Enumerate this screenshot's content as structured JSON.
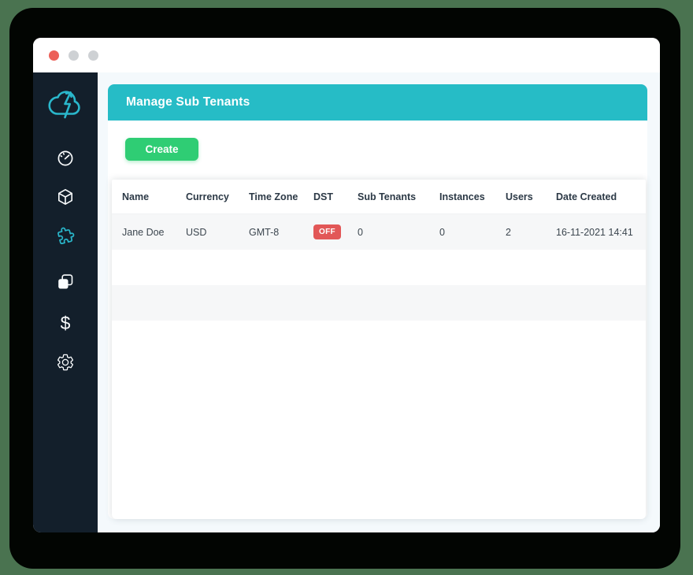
{
  "window_controls": {
    "buttons": [
      "close",
      "minimize",
      "maximize"
    ],
    "close_color": "#ec6058",
    "inactive_color": "#ced1d4"
  },
  "sidebar": {
    "logo_icon": "cloud-lightning-icon",
    "dollar_glyph": "$",
    "items": [
      {
        "icon": "speedometer-icon",
        "active": false
      },
      {
        "icon": "cube-icon",
        "active": false
      },
      {
        "icon": "puzzle-icon",
        "active": true
      },
      {
        "icon": "copy-icon",
        "active": false
      },
      {
        "icon": "dollar-icon",
        "active": false
      },
      {
        "icon": "gear-icon",
        "active": false
      }
    ]
  },
  "panel": {
    "title": "Manage Sub Tenants",
    "create_button_label": "Create"
  },
  "table": {
    "columns": [
      "Name",
      "Currency",
      "Time Zone",
      "DST",
      "Sub Tenants",
      "Instances",
      "Users",
      "Date Created"
    ],
    "row": {
      "name": "Jane Doe",
      "currency": "USD",
      "time_zone": "GMT-8",
      "dst_badge": "OFF",
      "sub_tenants": "0",
      "instances": "0",
      "users": "2",
      "date_created": "16-11-2021 14:41"
    },
    "skeleton_row_count": 3
  },
  "colors": {
    "page_background": "#4a7350",
    "backdrop": "#020502",
    "sidebar_background": "#131f2b",
    "header_teal": "#26bcc6",
    "accent_teal": "#2ab7cb",
    "create_green": "#2fcd74",
    "dst_red": "#e25757",
    "content_background": "#f4f9fc",
    "row_stripe": "#f6f7f8",
    "skeleton_bar": "#e3e3e5"
  }
}
